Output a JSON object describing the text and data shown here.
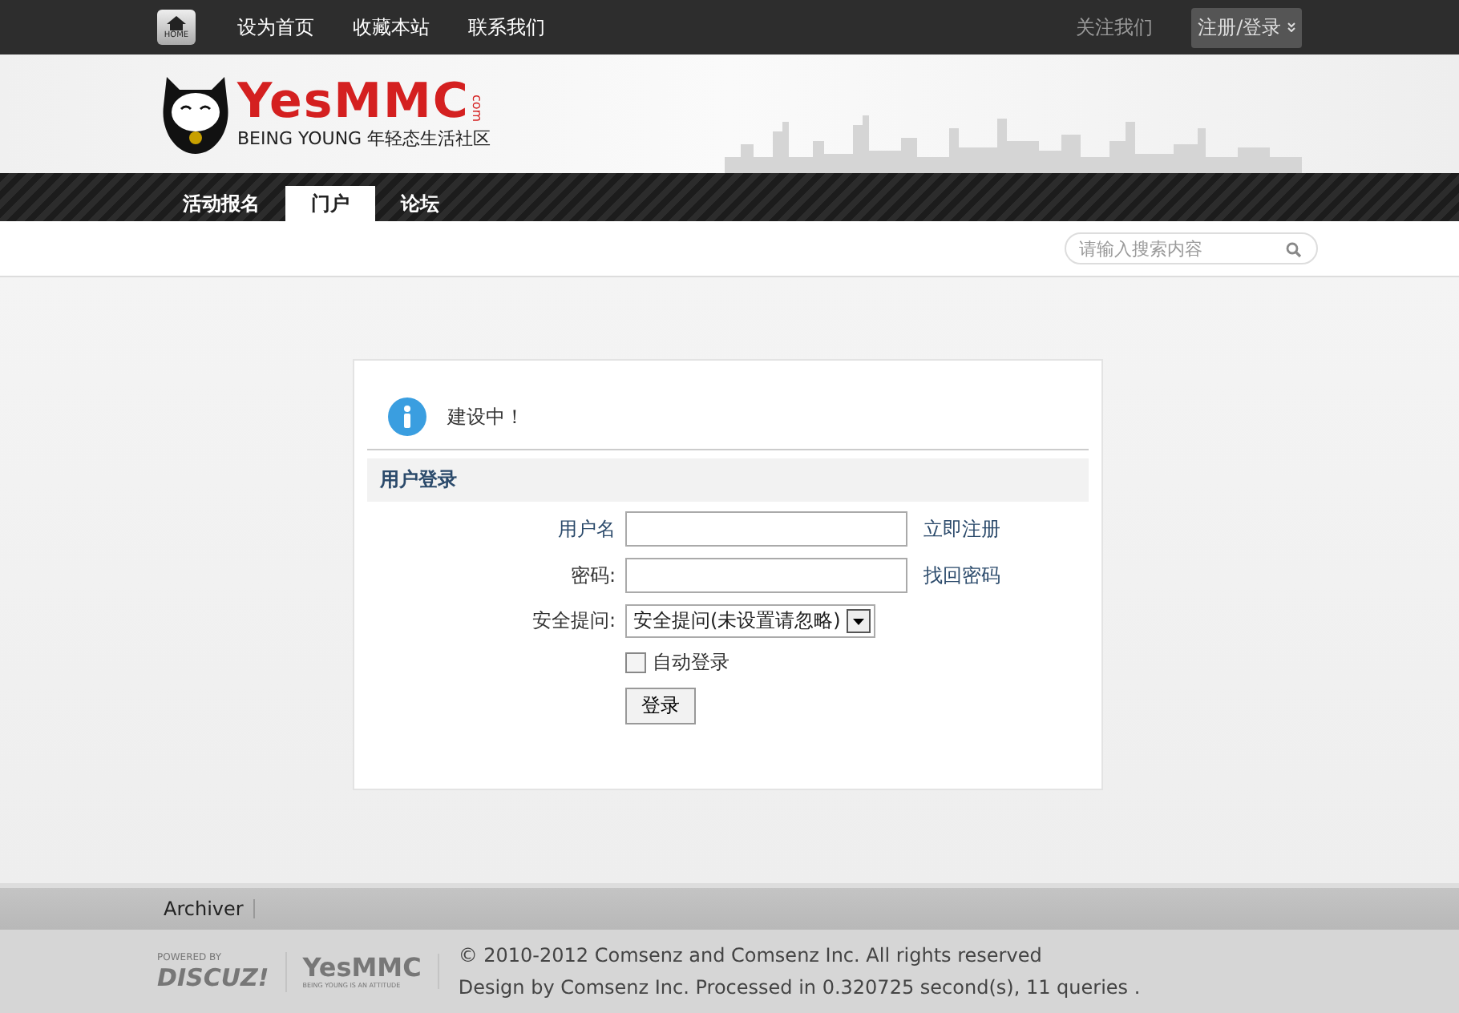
{
  "top_bar": {
    "home_label": "HOME",
    "links": [
      "设为首页",
      "收藏本站",
      "联系我们"
    ],
    "follow": "关注我们",
    "login_menu": "注册/登录"
  },
  "header": {
    "logo_title": "YesMMC",
    "logo_suffix": "com",
    "logo_tagline": "BEING YOUNG 年轻态生活社区"
  },
  "nav": [
    {
      "label": "活动报名",
      "selected": false
    },
    {
      "label": "门户",
      "selected": true
    },
    {
      "label": "论坛",
      "selected": false
    }
  ],
  "search": {
    "placeholder": "请输入搜索内容"
  },
  "notice": "建设中！",
  "login": {
    "title": "用户登录",
    "username_label": "用户名",
    "register_link": "立即注册",
    "password_label": "密码:",
    "recover_link": "找回密码",
    "question_label": "安全提问:",
    "question_value": "安全提问(未设置请忽略)",
    "auto_login": {
      "label": "自动登录",
      "checked": false
    },
    "submit": "登录"
  },
  "footer": {
    "links": [
      "Archiver"
    ],
    "powered_by": "POWERED BY",
    "discuz": "DISCUZ!",
    "logo": "YesMMC",
    "logo_tagline": "BEING YOUNG IS AN ATTITUDE",
    "copyright": "© 2010-2012 Comsenz  and Comsenz Inc. All rights reserved",
    "design": "Design by Comsenz Inc.  Processed in 0.320725 second(s), 11 queries ."
  }
}
